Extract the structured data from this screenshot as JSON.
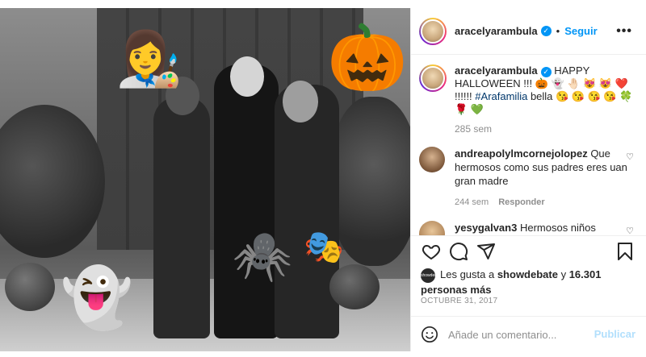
{
  "post": {
    "author": "aracelyarambula",
    "follow_label": "Seguir",
    "separator": "•",
    "more_label": "•••"
  },
  "caption": {
    "username": "aracelyarambula",
    "text_before": " HAPPY HALLOWEEN !!! 🎃 👻 🤚🏻 😻 😻 ❤️ !!!!!! ",
    "hashtag": "#Arafamilia",
    "text_after": " bella 😘 😘 😘 😘 🍀 🌹 💚",
    "time": "285 sem"
  },
  "comments": [
    {
      "username": "andreapolylmcornejolopez",
      "text": " Que hermosos como sus padres eres uan gran madre",
      "time": "244 sem",
      "reply_label": "Responder"
    },
    {
      "username": "yesygalvan3",
      "text": " Hermosos niños",
      "time": "",
      "reply_label": ""
    }
  ],
  "likes": {
    "avatar_text": "showdebate",
    "prefix": "Les gusta a ",
    "user": "showdebate",
    "middle": " y ",
    "count": "16.301 personas más"
  },
  "date": "OCTUBRE 31, 2017",
  "composer": {
    "placeholder": "Añade un comentario...",
    "publish_label": "Publicar"
  },
  "colors": {
    "accent": "#0095f6",
    "muted": "#8e8e8e",
    "hashtag": "#00376b",
    "publish_disabled": "#b2dffc"
  },
  "icons": {
    "verified": "verified-badge-icon",
    "more": "more-options-icon",
    "like": "heart-icon",
    "comment": "comment-bubble-icon",
    "share": "paper-plane-icon",
    "save": "bookmark-icon",
    "emoji": "smiley-icon"
  }
}
